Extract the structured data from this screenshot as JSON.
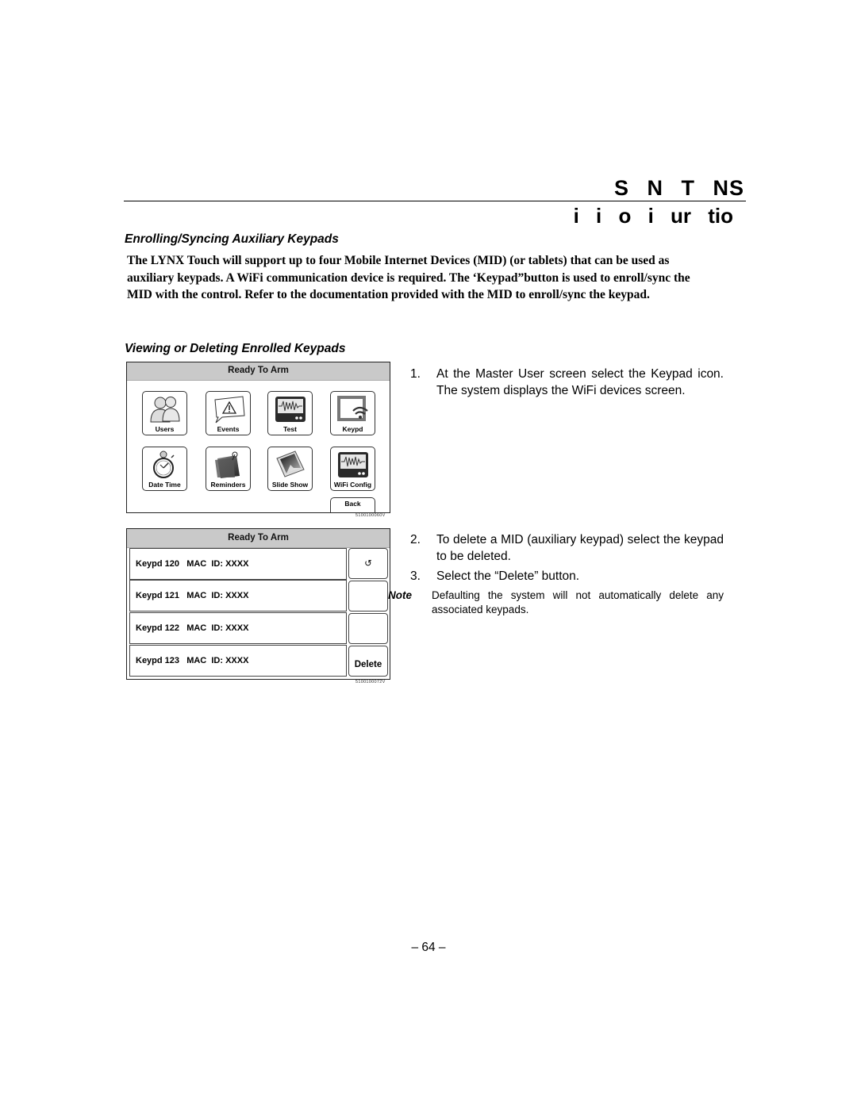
{
  "header": {
    "title": "S N T NS",
    "subtitle": "i i o i ur tio"
  },
  "section_enroll": {
    "heading": "Enrolling/Syncing Auxiliary Keypads",
    "body": "The LYNX Touch will support up to four Mobile Internet Devices (MID) (or tablets) that can be used as auxiliary keypads. A WiFi communication device is required. The ‘Keypad”button is used to enroll/sync the MID with the control. Refer to the documentation provided with the MID to enroll/sync the keypad."
  },
  "section_view": {
    "heading": "Viewing or Deleting Enrolled Keypads"
  },
  "screen_master": {
    "status": "Ready To Arm",
    "tiles": [
      {
        "label": "Users",
        "icon": "users-icon"
      },
      {
        "label": "Events",
        "icon": "events-warning-icon"
      },
      {
        "label": "Test",
        "icon": "test-waveform-icon"
      },
      {
        "label": "Keypd",
        "icon": "keypad-wifi-icon"
      },
      {
        "label": "Date Time",
        "icon": "stopwatch-icon"
      },
      {
        "label": "Reminders",
        "icon": "reminders-note-icon"
      },
      {
        "label": "Slide Show",
        "icon": "slide-show-photo-icon"
      },
      {
        "label": "WiFi Config",
        "icon": "wifi-config-waveform-icon"
      }
    ],
    "back_label": "Back",
    "figure_id": "5100100060V"
  },
  "screen_keypads": {
    "status": "Ready To Arm",
    "rows": [
      {
        "label": "Keypd 120   MAC  ID: XXXX"
      },
      {
        "label": "Keypd 121   MAC  ID: XXXX"
      },
      {
        "label": "Keypd 122   MAC  ID: XXXX"
      },
      {
        "label": "Keypd 123   MAC  ID: XXXX"
      }
    ],
    "side_buttons": [
      {
        "label": "↺",
        "icon": "back-arrow-icon"
      },
      {
        "label": ""
      },
      {
        "label": ""
      },
      {
        "label": "Delete"
      }
    ],
    "figure_id": "5100100072V"
  },
  "steps": [
    {
      "num": "1.",
      "text": "At the Master User screen select the Keypad icon. The system displays the WiFi devices screen."
    },
    {
      "num": "2.",
      "text": "To delete a MID (auxiliary keypad) select the keypad to be deleted."
    },
    {
      "num": "3.",
      "text": "Select the “Delete” button."
    }
  ],
  "note": {
    "label": "Note",
    "text": "Defaulting the system will not automatically delete any associated keypads."
  },
  "page_number": "– 64 –"
}
